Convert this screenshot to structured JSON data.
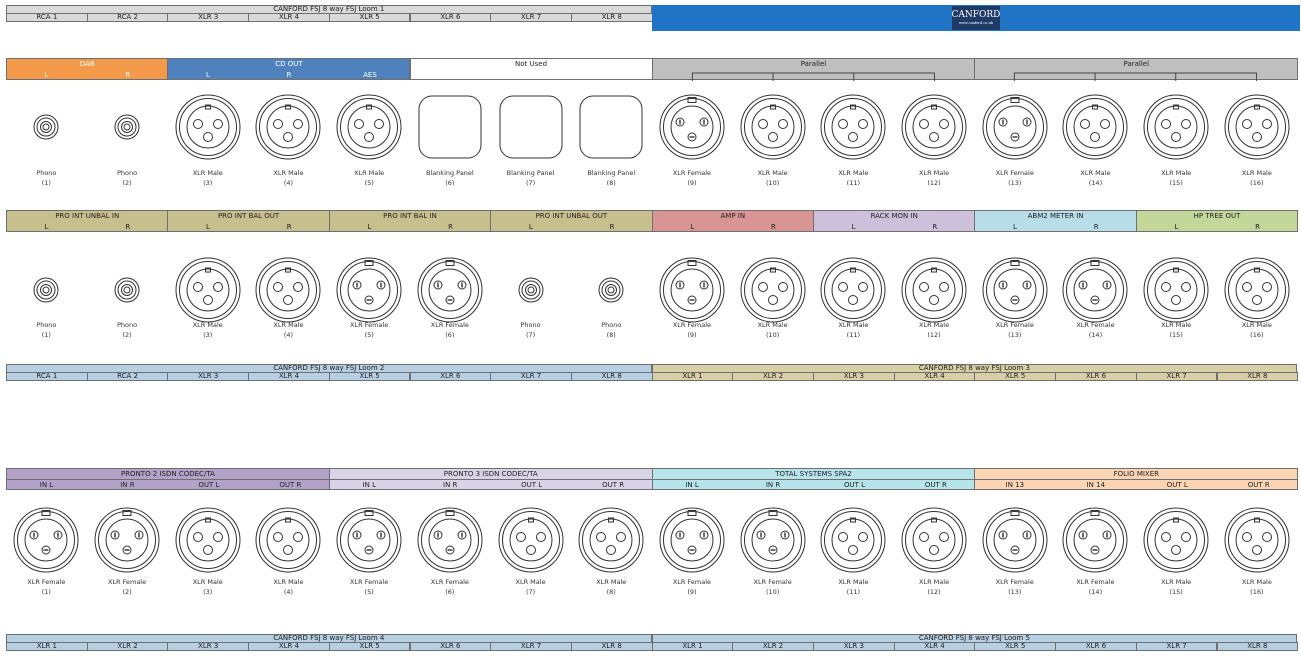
{
  "colors": {
    "loom_grey": "#d9d9d9",
    "loom_blue": "#b7cfe3",
    "loom_tan": "#d8cfa6",
    "canford_blue": "#1f74c6",
    "orange": "#f29a4a",
    "blue": "#4f81bd",
    "grey": "#bfbfbf",
    "khaki": "#c8bf8e",
    "rose": "#d99594",
    "lavender": "#ccc0da",
    "cyan": "#b6dde8",
    "green": "#c4d79b",
    "purple": "#b3a2c7",
    "lilac": "#d9d3e8",
    "aqua": "#b7e3ea",
    "peach": "#fbd4b4"
  },
  "logo": {
    "brand": "CANFORD",
    "tagline": "www.canford.co.uk"
  },
  "loom1": {
    "title": "CANFORD FSJ 8 way FSJ Loom 1",
    "cells": [
      "RCA 1",
      "RCA 2",
      "XLR 3",
      "XLR 4",
      "XLR 5",
      "XLR 6",
      "XLR 7",
      "XLR 8"
    ]
  },
  "row1": {
    "groups": [
      {
        "title": "DAB",
        "subs": [
          "L",
          "R"
        ],
        "color": "#f29a4a"
      },
      {
        "title": "CD OUT",
        "subs": [
          "L",
          "R",
          "AES"
        ],
        "color": "#4f81bd"
      },
      {
        "title": "Not Used",
        "subs": [],
        "color": "#ffffff"
      },
      {
        "title": "Parallel",
        "subs": [],
        "color": "#bfbfbf"
      },
      {
        "title": "Parallel",
        "subs": [],
        "color": "#bfbfbf"
      }
    ],
    "connectors": [
      {
        "type": "phono",
        "name": "Phono",
        "num": "(1)"
      },
      {
        "type": "phono",
        "name": "Phono",
        "num": "(2)"
      },
      {
        "type": "male",
        "name": "XLR Male",
        "num": "(3)"
      },
      {
        "type": "male",
        "name": "XLR Male",
        "num": "(4)"
      },
      {
        "type": "male",
        "name": "XLR Male",
        "num": "(5)"
      },
      {
        "type": "blank",
        "name": "Blanking Panel",
        "num": "(6)"
      },
      {
        "type": "blank",
        "name": "Blanking Panel",
        "num": "(7)"
      },
      {
        "type": "blank",
        "name": "Blanking Panel",
        "num": "(8)"
      },
      {
        "type": "female",
        "name": "XLR Female",
        "num": "(9)"
      },
      {
        "type": "male",
        "name": "XLR Male",
        "num": "(10)"
      },
      {
        "type": "male",
        "name": "XLR Male",
        "num": "(11)"
      },
      {
        "type": "male",
        "name": "XLR Male",
        "num": "(12)"
      },
      {
        "type": "female",
        "name": "XLR Female",
        "num": "(13)"
      },
      {
        "type": "male",
        "name": "XLR Male",
        "num": "(14)"
      },
      {
        "type": "male",
        "name": "XLR Male",
        "num": "(15)"
      },
      {
        "type": "male",
        "name": "XLR Male",
        "num": "(16)"
      }
    ]
  },
  "row2": {
    "groups": [
      {
        "title": "PRO INT UNBAL IN",
        "subs": [
          "L",
          "R"
        ],
        "color": "#c8bf8e"
      },
      {
        "title": "PRO INT BAL OUT",
        "subs": [
          "L",
          "R"
        ],
        "color": "#c8bf8e"
      },
      {
        "title": "PRO INT BAL IN",
        "subs": [
          "L",
          "R"
        ],
        "color": "#c8bf8e"
      },
      {
        "title": "PRO INT UNBAL OUT",
        "subs": [
          "L",
          "R"
        ],
        "color": "#c8bf8e"
      },
      {
        "title": "AMP  IN",
        "subs": [
          "L",
          "R"
        ],
        "color": "#d99594"
      },
      {
        "title": "RACK MON IN",
        "subs": [
          "L",
          "R"
        ],
        "color": "#ccc0da"
      },
      {
        "title": "ABM2 METER IN",
        "subs": [
          "L",
          "R"
        ],
        "color": "#b6dde8"
      },
      {
        "title": "HP TREE OUT",
        "subs": [
          "L",
          "R"
        ],
        "color": "#c4d79b"
      }
    ],
    "connectors": [
      {
        "type": "phono",
        "name": "Phono",
        "num": "(1)"
      },
      {
        "type": "phono",
        "name": "Phono",
        "num": "(2)"
      },
      {
        "type": "male",
        "name": "XLR Male",
        "num": "(3)"
      },
      {
        "type": "male",
        "name": "XLR Male",
        "num": "(4)"
      },
      {
        "type": "female",
        "name": "XLR Female",
        "num": "(5)"
      },
      {
        "type": "female",
        "name": "XLR Female",
        "num": "(6)"
      },
      {
        "type": "phono",
        "name": "Phono",
        "num": "(7)"
      },
      {
        "type": "phono",
        "name": "Phono",
        "num": "(8)"
      },
      {
        "type": "female",
        "name": "XLR Female",
        "num": "(9)"
      },
      {
        "type": "male",
        "name": "XLR Male",
        "num": "(10)"
      },
      {
        "type": "male",
        "name": "XLR Male",
        "num": "(11)"
      },
      {
        "type": "male",
        "name": "XLR Male",
        "num": "(12)"
      },
      {
        "type": "female",
        "name": "XLR Female",
        "num": "(13)"
      },
      {
        "type": "female",
        "name": "XLR Female",
        "num": "(14)"
      },
      {
        "type": "male",
        "name": "XLR Male",
        "num": "(15)"
      },
      {
        "type": "male",
        "name": "XLR Male",
        "num": "(16)"
      }
    ]
  },
  "loom2": {
    "title": "CANFORD FSJ 8 way FSJ Loom 2",
    "cells": [
      "RCA 1",
      "RCA  2",
      "XLR 3",
      "XLR 4",
      "XLR 5",
      "XLR 6",
      "XLR 7",
      "XLR 8"
    ]
  },
  "loom3": {
    "title": "CANFORD FSJ 8 way FSJ Loom 3",
    "cells": [
      "XLR 1",
      "XLR 2",
      "XLR 3",
      "XLR 4",
      "XLR 5",
      "XLR 6",
      "XLR 7",
      "XLR 8"
    ]
  },
  "row3": {
    "groups": [
      {
        "title": "PRONTO 2 ISDN CODEC/TA",
        "subs": [
          "IN L",
          "IN R",
          "OUT L",
          "OUT R"
        ],
        "color": "#b3a2c7"
      },
      {
        "title": "PRONTO 3 ISDN CODEC/TA",
        "subs": [
          "IN L",
          "IN R",
          "OUT L",
          "OUT R"
        ],
        "color": "#d9d3e8"
      },
      {
        "title": "TOTAL SYSTEMS SPA2",
        "subs": [
          "IN L",
          "IN R",
          "OUT L",
          "OUT R"
        ],
        "color": "#b7e3ea"
      },
      {
        "title": "FOLIO MIXER",
        "subs": [
          "IN 13",
          "IN 14",
          "OUT L",
          "OUT R"
        ],
        "color": "#fbd4b4"
      }
    ],
    "connectors": [
      {
        "type": "female",
        "name": "XLR Female",
        "num": "(1)"
      },
      {
        "type": "female",
        "name": "XLR Female",
        "num": "(2)"
      },
      {
        "type": "male",
        "name": "XLR Male",
        "num": "(3)"
      },
      {
        "type": "male",
        "name": "XLR Male",
        "num": "(4)"
      },
      {
        "type": "female",
        "name": "XLR Female",
        "num": "(5)"
      },
      {
        "type": "female",
        "name": "XLR Female",
        "num": "(6)"
      },
      {
        "type": "male",
        "name": "XLR Male",
        "num": "(7)"
      },
      {
        "type": "male",
        "name": "XLR Male",
        "num": "(8)"
      },
      {
        "type": "female",
        "name": "XLR Female",
        "num": "(9)"
      },
      {
        "type": "female",
        "name": "XLR Female",
        "num": "(10)"
      },
      {
        "type": "male",
        "name": "XLR Male",
        "num": "(11)"
      },
      {
        "type": "male",
        "name": "XLR Male",
        "num": "(12)"
      },
      {
        "type": "female",
        "name": "XLR Female",
        "num": "(13)"
      },
      {
        "type": "female",
        "name": "XLR Female",
        "num": "(14)"
      },
      {
        "type": "male",
        "name": "XLR Male",
        "num": "(15)"
      },
      {
        "type": "male",
        "name": "XLR Male",
        "num": "(16)"
      }
    ]
  },
  "loom4": {
    "title": "CANFORD FSJ 8 way FSJ Loom 4",
    "cells": [
      "XLR 1",
      "XLR 2",
      "XLR 3",
      "XLR 4",
      "XLR 5",
      "XLR 6",
      "XLR 7",
      "XLR 8"
    ]
  },
  "loom5": {
    "title": "CANFORD FSJ 8 way FSJ Loom 5",
    "cells": [
      "XLR 1",
      "XLR 2",
      "XLR 3",
      "XLR 4",
      "XLR 5",
      "XLR 6",
      "XLR 7",
      "XLR 8"
    ]
  }
}
